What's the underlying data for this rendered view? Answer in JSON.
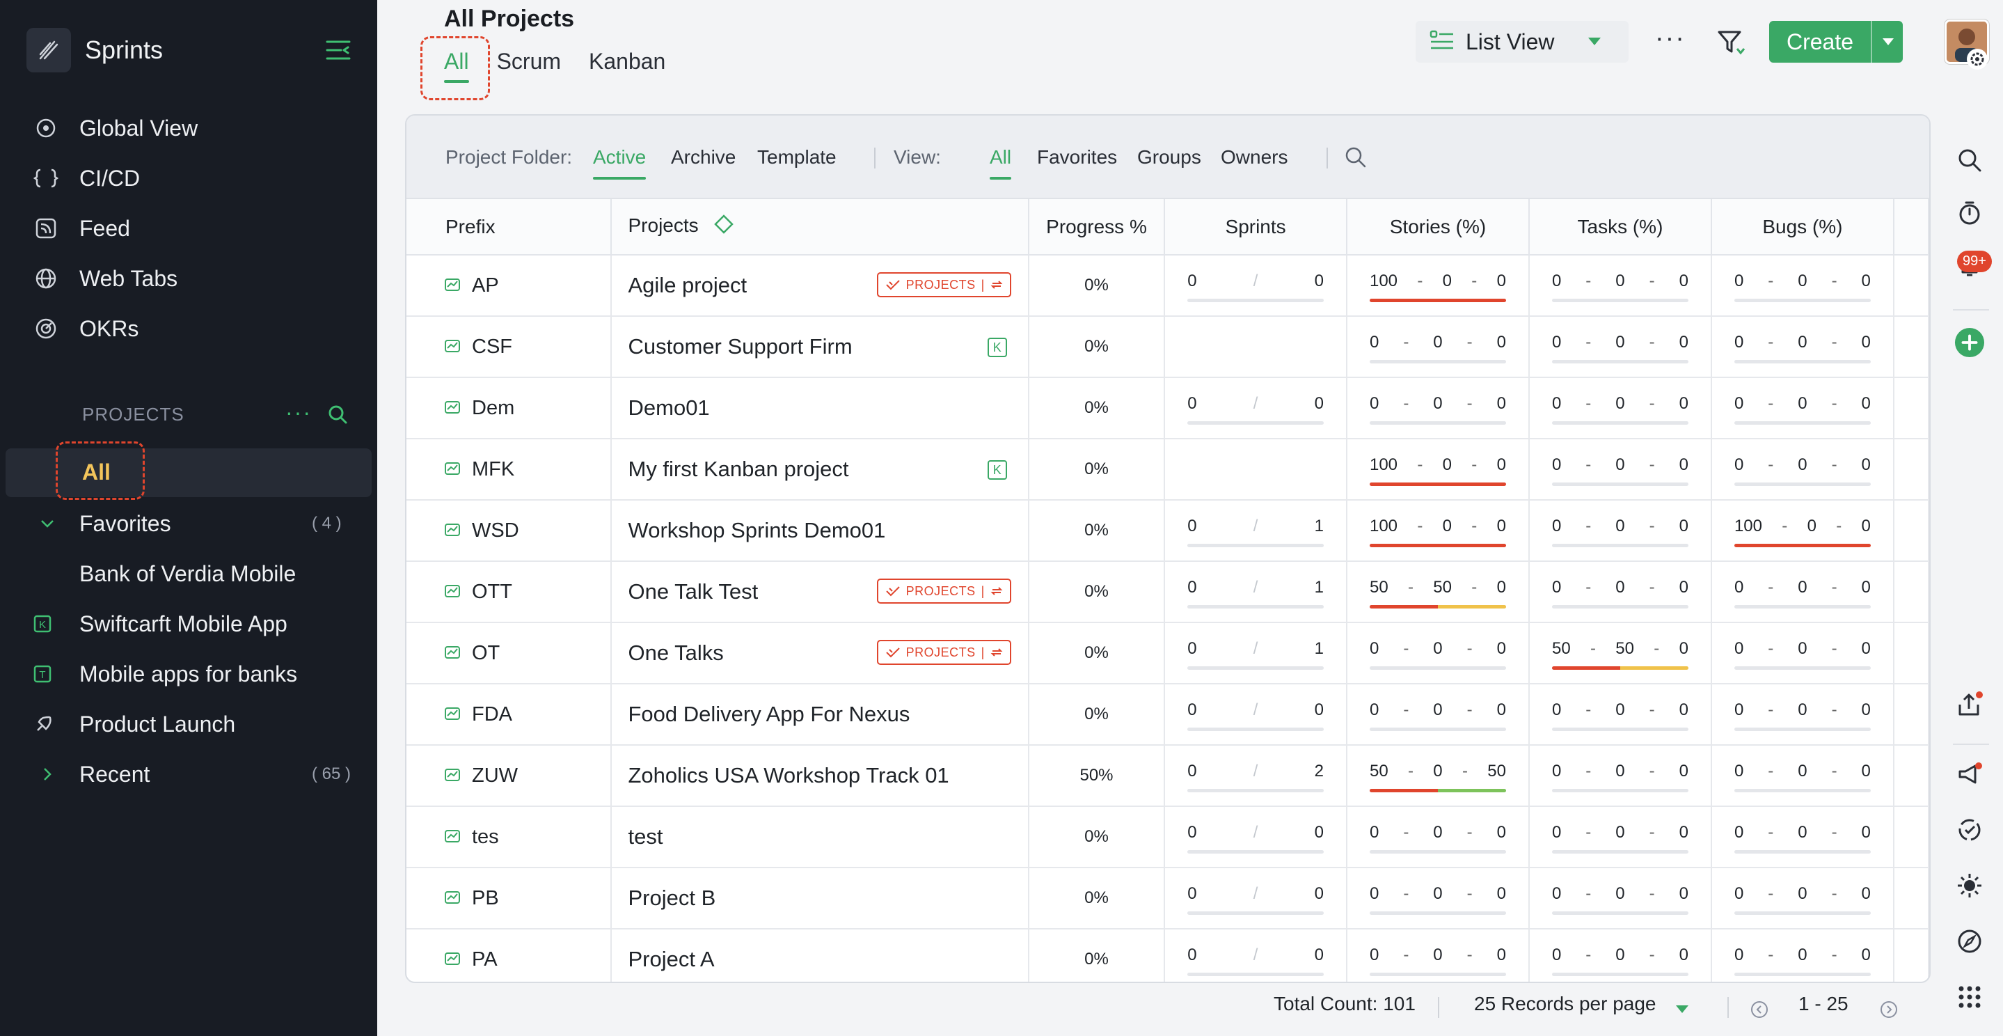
{
  "sidebar": {
    "brand": "Sprints",
    "nav": [
      {
        "label": "Global View",
        "icon": "eye-icon"
      },
      {
        "label": "CI/CD",
        "icon": "code-icon"
      },
      {
        "label": "Feed",
        "icon": "feed-icon"
      },
      {
        "label": "Web Tabs",
        "icon": "globe-icon"
      },
      {
        "label": "OKRs",
        "icon": "target-icon"
      }
    ],
    "projects_heading": "PROJECTS",
    "all_label": "All",
    "favorites_label": "Favorites",
    "favorites_count": "( 4 )",
    "favorite_items": [
      "Bank of Verdia Mobile",
      "Swiftcarft Mobile App",
      "Mobile apps for banks",
      "Product Launch"
    ],
    "recent_label": "Recent",
    "recent_count": "( 65 )"
  },
  "header": {
    "title": "All Projects",
    "tabs": [
      "All",
      "Scrum",
      "Kanban"
    ],
    "view_label": "List View",
    "create_label": "Create"
  },
  "toolbar": {
    "folder_label": "Project Folder:",
    "folders": [
      "Active",
      "Archive",
      "Template"
    ],
    "view_label": "View:",
    "views": [
      "All",
      "Favorites",
      "Groups",
      "Owners"
    ]
  },
  "table": {
    "columns": [
      "Prefix",
      "Projects",
      "Progress %",
      "Sprints",
      "Stories (%)",
      "Tasks (%)",
      "Bugs (%)"
    ],
    "badge_text": "PROJECTS",
    "k_text": "K",
    "rows": [
      {
        "prefix": "AP",
        "name": "Agile project",
        "badge": "projects",
        "progress": "0%",
        "sprints": [
          "0",
          "0"
        ],
        "stories": [
          "100",
          "0",
          "0"
        ],
        "tasks": [
          "0",
          "0",
          "0"
        ],
        "bugs": [
          "0",
          "0",
          "0"
        ]
      },
      {
        "prefix": "CSF",
        "name": "Customer Support Firm",
        "badge": "k",
        "progress": "0%",
        "sprints": null,
        "stories": [
          "0",
          "0",
          "0"
        ],
        "tasks": [
          "0",
          "0",
          "0"
        ],
        "bugs": [
          "0",
          "0",
          "0"
        ]
      },
      {
        "prefix": "Dem",
        "name": "Demo01",
        "badge": "",
        "progress": "0%",
        "sprints": [
          "0",
          "0"
        ],
        "stories": [
          "0",
          "0",
          "0"
        ],
        "tasks": [
          "0",
          "0",
          "0"
        ],
        "bugs": [
          "0",
          "0",
          "0"
        ]
      },
      {
        "prefix": "MFK",
        "name": "My first Kanban project",
        "badge": "k",
        "progress": "0%",
        "sprints": null,
        "stories": [
          "100",
          "0",
          "0"
        ],
        "tasks": [
          "0",
          "0",
          "0"
        ],
        "bugs": [
          "0",
          "0",
          "0"
        ]
      },
      {
        "prefix": "WSD",
        "name": "Workshop Sprints Demo01",
        "badge": "",
        "progress": "0%",
        "sprints": [
          "0",
          "1"
        ],
        "stories": [
          "100",
          "0",
          "0"
        ],
        "tasks": [
          "0",
          "0",
          "0"
        ],
        "bugs": [
          "100",
          "0",
          "0"
        ]
      },
      {
        "prefix": "OTT",
        "name": "One Talk Test",
        "badge": "projects",
        "progress": "0%",
        "sprints": [
          "0",
          "1"
        ],
        "stories": [
          "50",
          "50",
          "0"
        ],
        "tasks": [
          "0",
          "0",
          "0"
        ],
        "bugs": [
          "0",
          "0",
          "0"
        ]
      },
      {
        "prefix": "OT",
        "name": "One Talks",
        "badge": "projects",
        "progress": "0%",
        "sprints": [
          "0",
          "1"
        ],
        "stories": [
          "0",
          "0",
          "0"
        ],
        "tasks": [
          "50",
          "50",
          "0"
        ],
        "bugs": [
          "0",
          "0",
          "0"
        ]
      },
      {
        "prefix": "FDA",
        "name": "Food Delivery App For Nexus",
        "badge": "",
        "progress": "0%",
        "sprints": [
          "0",
          "0"
        ],
        "stories": [
          "0",
          "0",
          "0"
        ],
        "tasks": [
          "0",
          "0",
          "0"
        ],
        "bugs": [
          "0",
          "0",
          "0"
        ]
      },
      {
        "prefix": "ZUW",
        "name": "Zoholics USA Workshop Track 01",
        "badge": "",
        "progress": "50%",
        "sprints": [
          "0",
          "2"
        ],
        "stories": [
          "50",
          "0",
          "50"
        ],
        "tasks": [
          "0",
          "0",
          "0"
        ],
        "bugs": [
          "0",
          "0",
          "0"
        ]
      },
      {
        "prefix": "tes",
        "name": "test",
        "badge": "",
        "progress": "0%",
        "sprints": [
          "0",
          "0"
        ],
        "stories": [
          "0",
          "0",
          "0"
        ],
        "tasks": [
          "0",
          "0",
          "0"
        ],
        "bugs": [
          "0",
          "0",
          "0"
        ]
      },
      {
        "prefix": "PB",
        "name": "Project B",
        "badge": "",
        "progress": "0%",
        "sprints": [
          "0",
          "0"
        ],
        "stories": [
          "0",
          "0",
          "0"
        ],
        "tasks": [
          "0",
          "0",
          "0"
        ],
        "bugs": [
          "0",
          "0",
          "0"
        ]
      },
      {
        "prefix": "PA",
        "name": "Project A",
        "badge": "",
        "progress": "0%",
        "sprints": [
          "0",
          "0"
        ],
        "stories": [
          "0",
          "0",
          "0"
        ],
        "tasks": [
          "0",
          "0",
          "0"
        ],
        "bugs": [
          "0",
          "0",
          "0"
        ]
      }
    ]
  },
  "footer": {
    "total": "Total Count: 101",
    "per_page": "25 Records per page",
    "range": "1 - 25"
  },
  "rail": {
    "notification_badge": "99+"
  },
  "colors": {
    "accent": "#3aa865",
    "danger": "#e0452d",
    "warning": "#f0c24a",
    "success": "#7dc35b",
    "sidebar_bg": "#181c24"
  }
}
